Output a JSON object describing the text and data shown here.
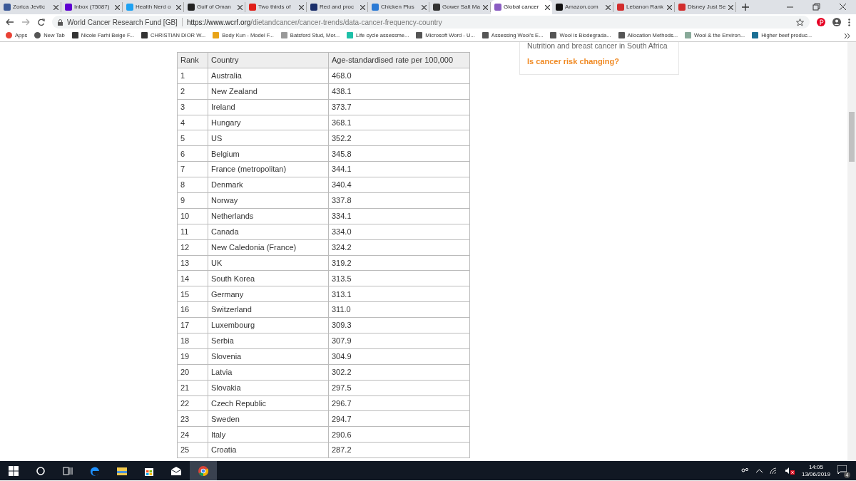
{
  "tabs": [
    {
      "title": "Zorica Jevtic",
      "selected": false,
      "color": "#3b5998"
    },
    {
      "title": "Inbox (75087)",
      "selected": false,
      "color": "#5f01d1"
    },
    {
      "title": "Health Nerd o",
      "selected": false,
      "color": "#1da1f2"
    },
    {
      "title": "Gulf of Oman",
      "selected": false,
      "color": "#222222"
    },
    {
      "title": "Two thirds of",
      "selected": false,
      "color": "#e0201a"
    },
    {
      "title": "Red and proc",
      "selected": false,
      "color": "#1a2f6b"
    },
    {
      "title": "Chicken Plus",
      "selected": false,
      "color": "#2a7ad5"
    },
    {
      "title": "Gower Salt Ma",
      "selected": false,
      "color": "#333333"
    },
    {
      "title": "Global cancer",
      "selected": true,
      "color": "#8a5cc2"
    },
    {
      "title": "Amazon.com",
      "selected": false,
      "color": "#111111"
    },
    {
      "title": "Lebanon Rank",
      "selected": false,
      "color": "#d22d2d"
    },
    {
      "title": "Disney Just Se",
      "selected": false,
      "color": "#d22d2d"
    }
  ],
  "address": {
    "site": "World Cancer Research Fund [GB]",
    "domain": "https://www.wcrf.org",
    "path": "/dietandcancer/cancer-trends/data-cancer-frequency-country"
  },
  "bookmarks": [
    {
      "label": "Apps",
      "color": "#e94235"
    },
    {
      "label": "New Tab",
      "color": "#555555"
    },
    {
      "label": "Nicole Farhi Beige F...",
      "color": "#333333"
    },
    {
      "label": "CHRISTIAN DIOR W...",
      "color": "#333333"
    },
    {
      "label": "Body Kun - Model F...",
      "color": "#e8a317"
    },
    {
      "label": "Batsford Stud, Mor...",
      "color": "#999999"
    },
    {
      "label": "Life cycle assessme...",
      "color": "#1ec0a8"
    },
    {
      "label": "Microsoft Word - U...",
      "color": "#555555"
    },
    {
      "label": "Assessing Wool's E...",
      "color": "#555555"
    },
    {
      "label": "Wool is Biodegrada...",
      "color": "#555555"
    },
    {
      "label": "Allocation Methods...",
      "color": "#555555"
    },
    {
      "label": "Wool & the Environ...",
      "color": "#88aa99"
    },
    {
      "label": "Higher beef produc...",
      "color": "#1b6f94"
    }
  ],
  "table": {
    "columns": [
      "Rank",
      "Country",
      "Age-standardised rate per 100,000"
    ],
    "rows": [
      [
        "1",
        "Australia",
        "468.0"
      ],
      [
        "2",
        "New Zealand",
        "438.1"
      ],
      [
        "3",
        "Ireland",
        "373.7"
      ],
      [
        "4",
        "Hungary",
        "368.1"
      ],
      [
        "5",
        "US",
        "352.2"
      ],
      [
        "6",
        "Belgium",
        "345.8"
      ],
      [
        "7",
        "France (metropolitan)",
        "344.1"
      ],
      [
        "8",
        "Denmark",
        "340.4"
      ],
      [
        "9",
        "Norway",
        "337.8"
      ],
      [
        "10",
        "Netherlands",
        "334.1"
      ],
      [
        "11",
        "Canada",
        "334.0"
      ],
      [
        "12",
        "New Caledonia (France)",
        "324.2"
      ],
      [
        "13",
        "UK",
        "319.2"
      ],
      [
        "14",
        "South Korea",
        "313.5"
      ],
      [
        "15",
        "Germany",
        "313.1"
      ],
      [
        "16",
        "Switzerland",
        "311.0"
      ],
      [
        "17",
        "Luxembourg",
        "309.3"
      ],
      [
        "18",
        "Serbia",
        "307.9"
      ],
      [
        "19",
        "Slovenia",
        "304.9"
      ],
      [
        "20",
        "Latvia",
        "302.2"
      ],
      [
        "21",
        "Slovakia",
        "297.5"
      ],
      [
        "22",
        "Czech Republic",
        "296.7"
      ],
      [
        "23",
        "Sweden",
        "294.7"
      ],
      [
        "24",
        "Italy",
        "290.6"
      ],
      [
        "25",
        "Croatia",
        "287.2"
      ]
    ]
  },
  "related": [
    {
      "title": "Nutrition and breast cancer in South Africa",
      "kind": "plain"
    },
    {
      "title": "Is cancer risk changing?",
      "kind": "highlight"
    }
  ],
  "taskbar": {
    "time": "14:05",
    "date": "13/06/2019",
    "notifications": "4"
  }
}
